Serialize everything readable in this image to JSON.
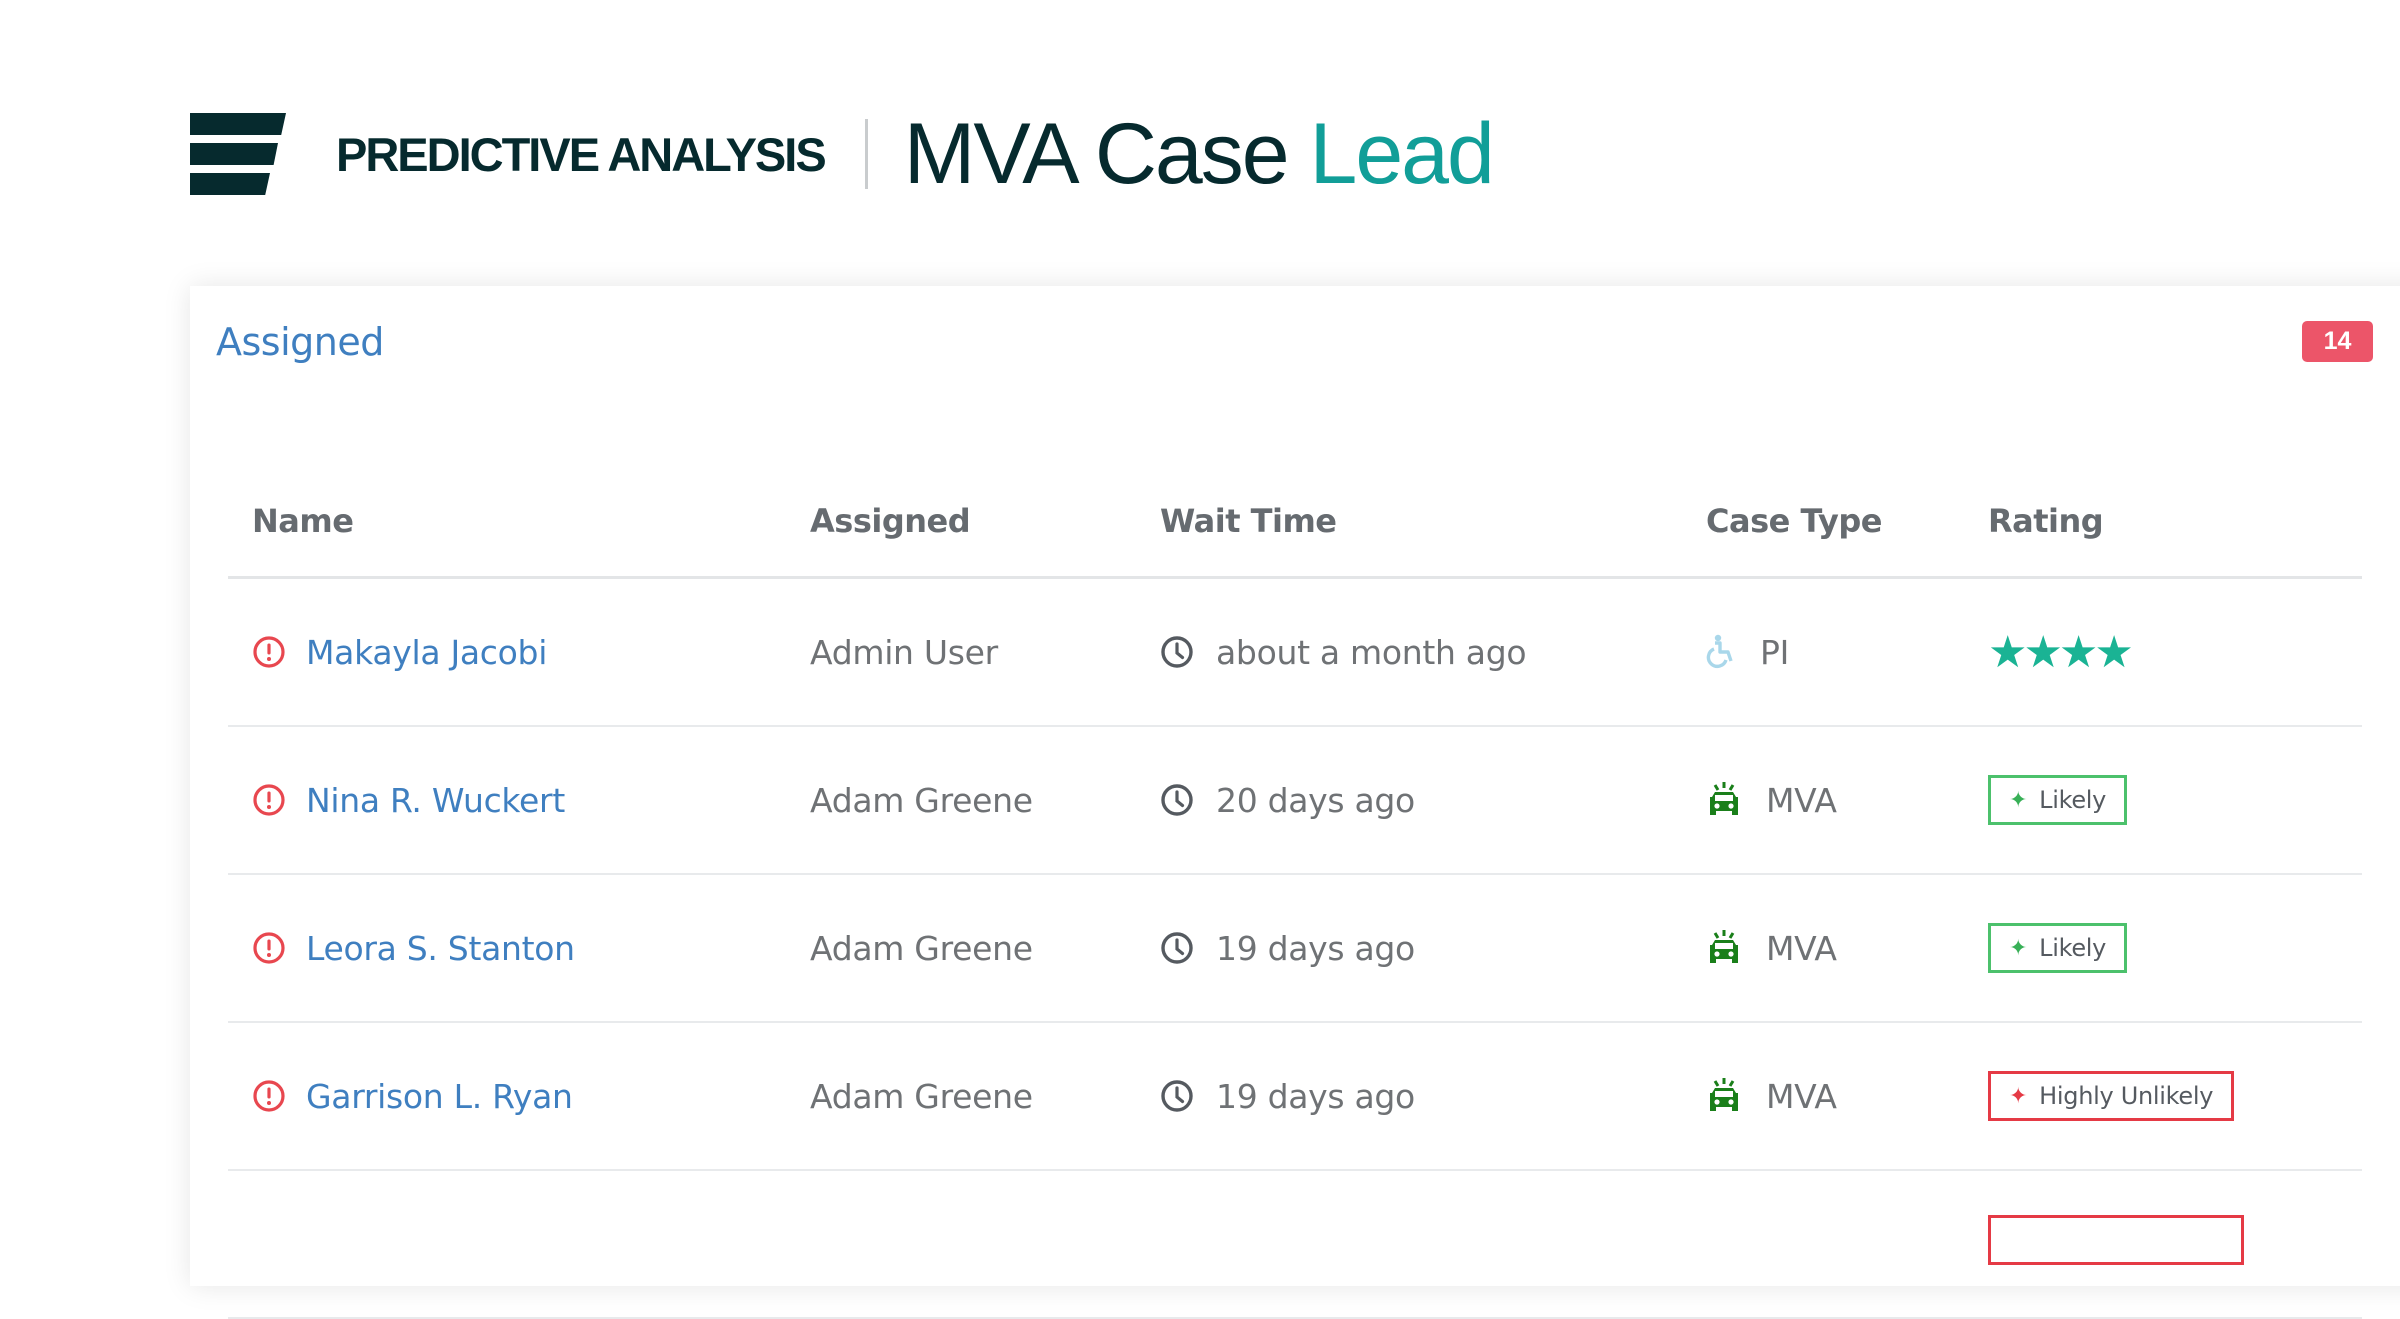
{
  "header": {
    "brand_name": "PREDICTIVE ANALYSIS",
    "title_main": "MVA Case",
    "title_accent": "Lead",
    "accent_color": "#119e98"
  },
  "card": {
    "title": "Assigned",
    "count": "14",
    "count_color": "#ec5569"
  },
  "table": {
    "columns": [
      "Name",
      "Assigned",
      "Wait Time",
      "Case Type",
      "Rating"
    ],
    "rows": [
      {
        "name": "Makayla Jacobi",
        "assigned": "Admin User",
        "wait": "about a month ago",
        "type": "PI",
        "type_icon": "wheelchair-icon",
        "rating_kind": "stars",
        "stars": 4,
        "rating": "4 stars"
      },
      {
        "name": "Nina R. Wuckert",
        "assigned": "Adam Greene",
        "wait": "20 days ago",
        "type": "MVA",
        "type_icon": "car-icon",
        "rating_kind": "badge",
        "rating": "Likely",
        "rating_status": "likely"
      },
      {
        "name": "Leora S. Stanton",
        "assigned": "Adam Greene",
        "wait": "19 days ago",
        "type": "MVA",
        "type_icon": "car-icon",
        "rating_kind": "badge",
        "rating": "Likely",
        "rating_status": "likely"
      },
      {
        "name": "Garrison L. Ryan",
        "assigned": "Adam Greene",
        "wait": "19 days ago",
        "type": "MVA",
        "type_icon": "car-icon",
        "rating_kind": "badge",
        "rating": "Highly Unlikely",
        "rating_status": "unlikely"
      }
    ],
    "stars_glyph": "★★★★",
    "spark_glyph": "✦"
  }
}
